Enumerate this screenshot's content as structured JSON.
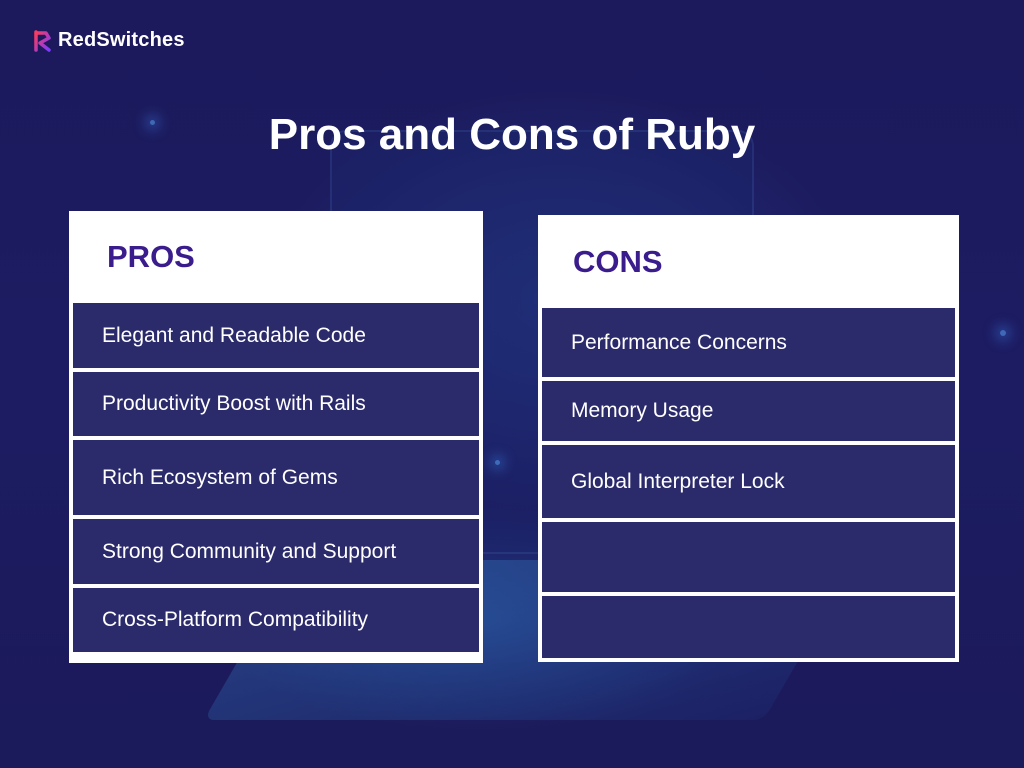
{
  "brand": {
    "name": "RedSwitches",
    "colors": {
      "logo_gradient_start": "#ff3b5c",
      "logo_gradient_end": "#7b3bff"
    }
  },
  "title": "Pros and Cons of Ruby",
  "colors": {
    "background": "#1b1a5e",
    "card": "#ffffff",
    "heading": "#3a1c8c",
    "row": "#1b1a60",
    "row_text": "#ffffff"
  },
  "pros": {
    "heading": "PROS",
    "items": [
      "Elegant and Readable Code",
      "Productivity Boost with Rails",
      "Rich Ecosystem of Gems",
      "Strong Community and Support",
      "Cross-Platform Compatibility"
    ]
  },
  "cons": {
    "heading": "CONS",
    "items": [
      "Performance Concerns",
      "Memory Usage",
      "Global Interpreter Lock",
      "",
      ""
    ]
  }
}
